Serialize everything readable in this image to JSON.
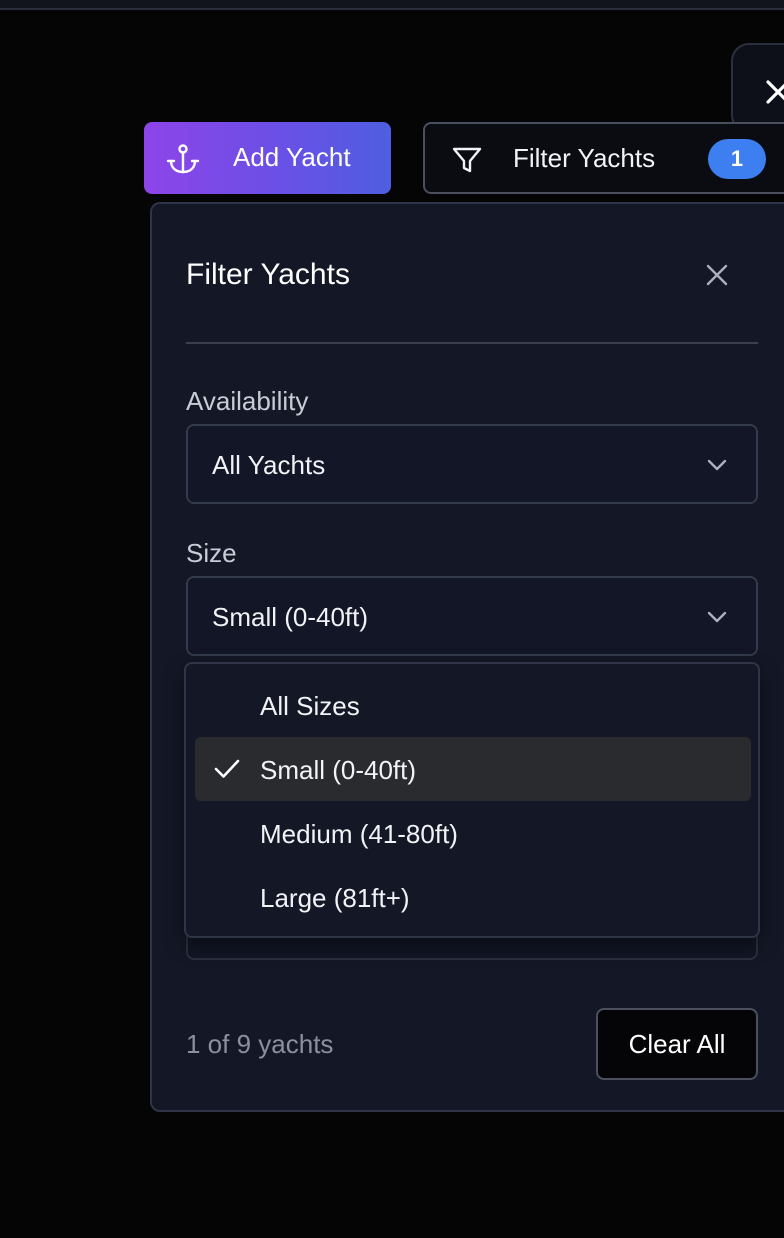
{
  "toolbar": {
    "add_label": "Add Yacht",
    "filter_label": "Filter Yachts",
    "filter_count": "1"
  },
  "panel": {
    "title": "Filter Yachts",
    "availability_label": "Availability",
    "availability_value": "All Yachts",
    "size_label": "Size",
    "size_value": "Small (0-40ft)",
    "count_text": "1 of 9 yachts",
    "clear_label": "Clear All"
  },
  "dropdown": {
    "options": [
      {
        "label": "All Sizes"
      },
      {
        "label": "Small (0-40ft)"
      },
      {
        "label": "Medium (41-80ft)"
      },
      {
        "label": "Large (81ft+)"
      }
    ]
  },
  "colors": {
    "accent_start": "#8e44e8",
    "accent_end": "#4f5ee0",
    "badge": "#3d7ff0",
    "panel_bg": "#141826",
    "page_bg": "#050505"
  },
  "icons": {
    "add": "anchor-icon",
    "filter": "filter-icon",
    "close": "close-icon",
    "chevron": "chevron-down-icon",
    "check": "check-icon"
  }
}
